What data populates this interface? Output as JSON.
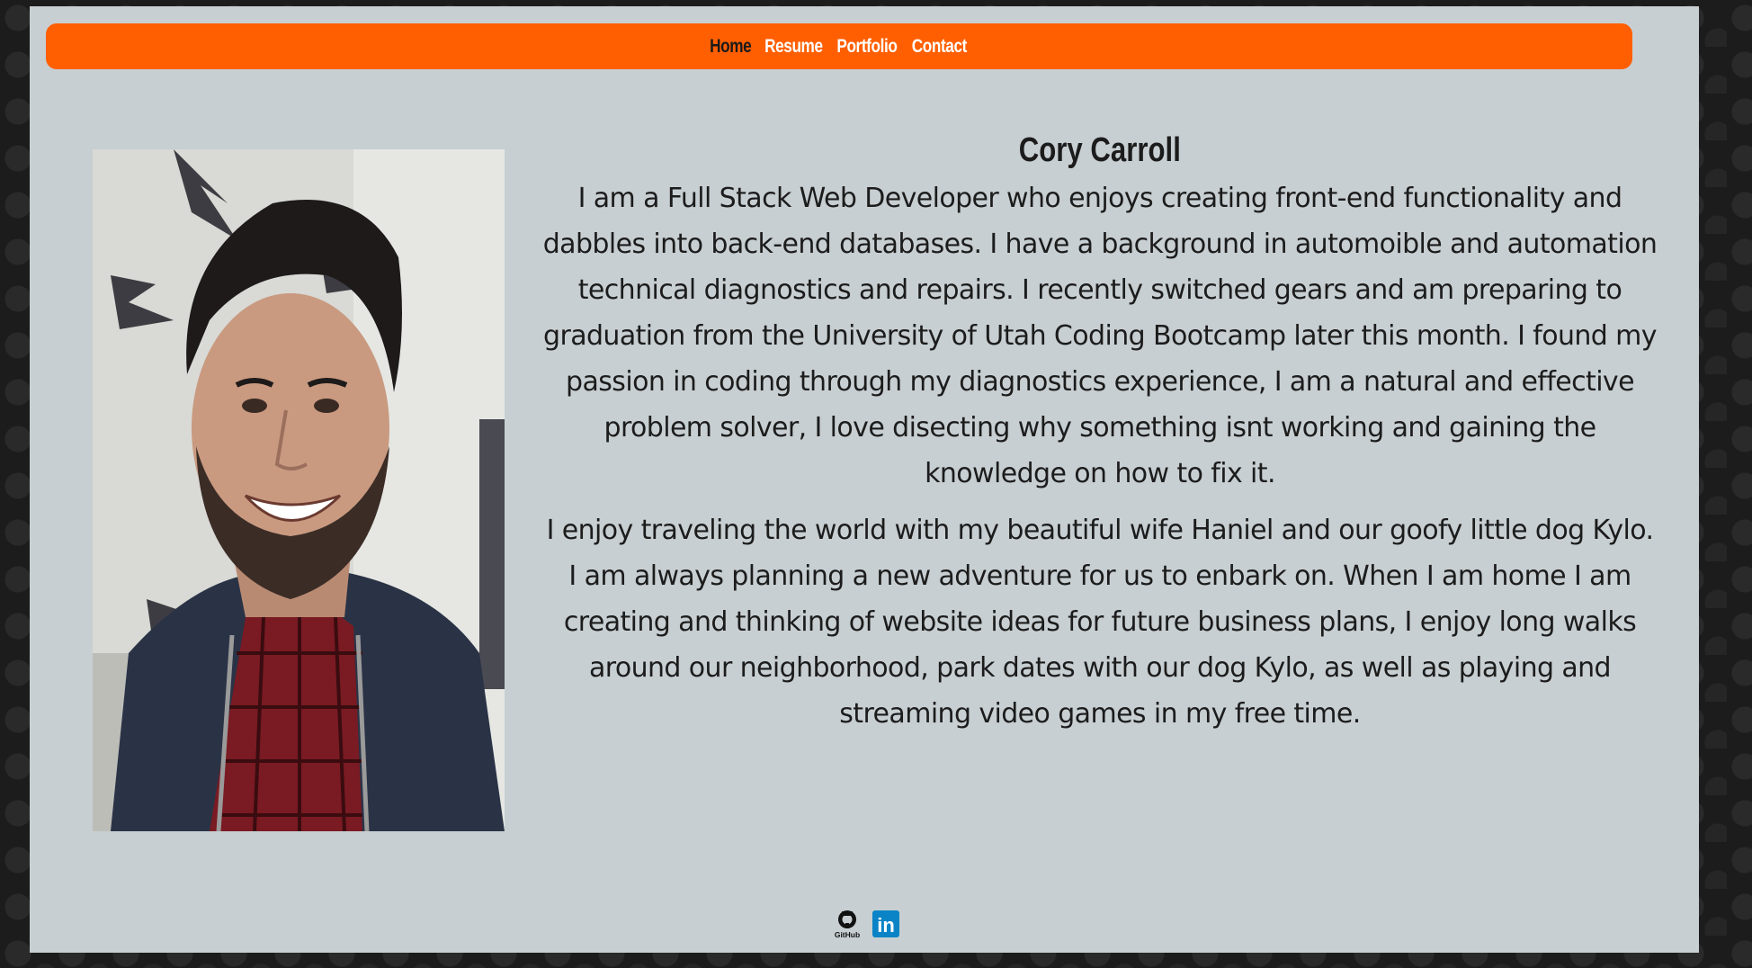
{
  "nav": {
    "items": [
      {
        "label": "Home",
        "active": true
      },
      {
        "label": "Resume",
        "active": false
      },
      {
        "label": "Portfolio",
        "active": false
      },
      {
        "label": "Contact",
        "active": false
      }
    ],
    "background_color": "#ff5f00"
  },
  "profile": {
    "name": "Cory Carroll",
    "bio_paragraphs": [
      "I am a Full Stack Web Developer who enjoys creating front-end functionality and dabbles into back-end databases. I have a background in automoible and automation technical diagnostics and repairs. I recently switched gears and am preparing to graduation from the University of Utah Coding Bootcamp later this month. I found my passion in coding through my diagnostics experience, I am a natural and effective problem solver, I love disecting why something isnt working and gaining the knowledge on how to fix it.",
      "I enjoy traveling the world with my beautiful wife Haniel and our goofy little dog Kylo. I am always planning a new adventure for us to enbark on. When I am home I am creating and thinking of website ideas for future business plans, I enjoy long walks around our neighborhood, park dates with our dog Kylo, as well as playing and streaming video games in my free time."
    ]
  },
  "social": {
    "github_label": "GitHub",
    "github_icon": "github-icon",
    "linkedin_label": "in",
    "linkedin_icon": "linkedin-icon",
    "linkedin_color": "#0a84c6"
  },
  "colors": {
    "panel": "#c8cfd2",
    "accent": "#ff5f00"
  }
}
